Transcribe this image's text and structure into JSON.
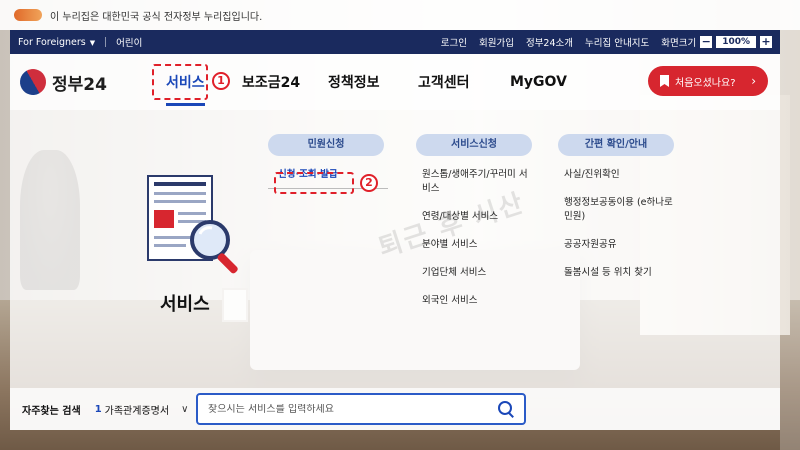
{
  "notice": {
    "text": "이 누리집은 대한민국 공식 전자정부 누리집입니다."
  },
  "topbar": {
    "foreigners": "For Foreigners",
    "kids": "어린이",
    "links": [
      "로그인",
      "회원가입",
      "정부24소개",
      "누리집 안내지도"
    ],
    "zoom_label": "화면크기",
    "zoom_minus": "−",
    "zoom_value": "100%",
    "zoom_plus": "+"
  },
  "header": {
    "logo_text": "정부24",
    "nav": [
      "서비스",
      "보조금24",
      "정책정보",
      "고객센터",
      "MyGOV"
    ],
    "first_visit": "처음오셨나요?",
    "first_arrow": "›"
  },
  "annotations": {
    "step1": "1",
    "step2": "2"
  },
  "panel": {
    "title": "서비스",
    "columns": [
      {
        "head": "민원신청",
        "items": [
          "신청·조회·발급"
        ]
      },
      {
        "head": "서비스신청",
        "items": [
          "원스톱/생애주기/꾸러미 서비스",
          "연령/대상별 서비스",
          "분야별 서비스",
          "기업단체 서비스",
          "외국인 서비스"
        ]
      },
      {
        "head": "간편 확인/안내",
        "items": [
          "사실/진위확인",
          "행정정보공동이용 (e하나로민원)",
          "공공자원공유",
          "돌봄시설 등 위치 찾기"
        ]
      }
    ]
  },
  "watermark": "퇴근 후 시산",
  "search": {
    "label": "자주찾는 검색",
    "rank": "1",
    "term": "가족관계증명서",
    "chevron": "∨",
    "placeholder": "찾으시는 서비스를 입력하세요"
  }
}
